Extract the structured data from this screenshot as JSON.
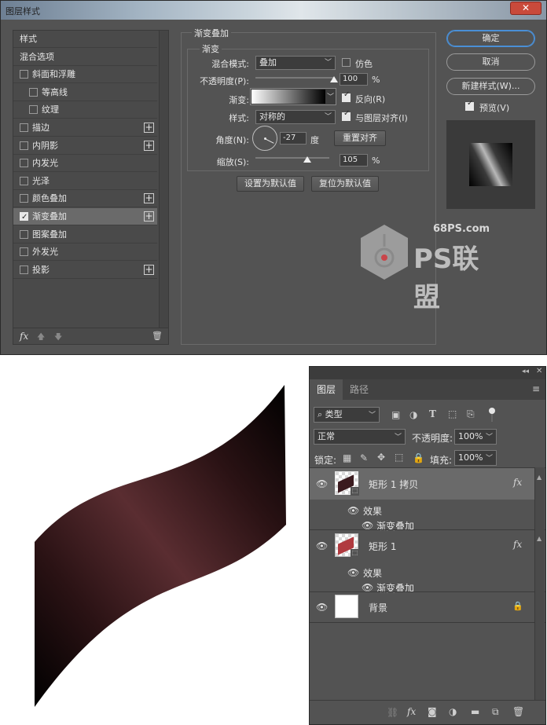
{
  "dialog": {
    "title": "图层样式",
    "close": "✕",
    "left_items": [
      {
        "label": "样式",
        "checkbox": false,
        "checked": false,
        "plus": false,
        "indent": 0
      },
      {
        "label": "混合选项",
        "checkbox": false,
        "checked": false,
        "plus": false,
        "indent": 0
      },
      {
        "label": "斜面和浮雕",
        "checkbox": true,
        "checked": false,
        "plus": false,
        "indent": 0
      },
      {
        "label": "等高线",
        "checkbox": true,
        "checked": false,
        "plus": false,
        "indent": 1
      },
      {
        "label": "纹理",
        "checkbox": true,
        "checked": false,
        "plus": false,
        "indent": 1
      },
      {
        "label": "描边",
        "checkbox": true,
        "checked": false,
        "plus": true,
        "indent": 0
      },
      {
        "label": "内阴影",
        "checkbox": true,
        "checked": false,
        "plus": true,
        "indent": 0
      },
      {
        "label": "内发光",
        "checkbox": true,
        "checked": false,
        "plus": false,
        "indent": 0
      },
      {
        "label": "光泽",
        "checkbox": true,
        "checked": false,
        "plus": false,
        "indent": 0
      },
      {
        "label": "颜色叠加",
        "checkbox": true,
        "checked": false,
        "plus": true,
        "indent": 0
      },
      {
        "label": "渐变叠加",
        "checkbox": true,
        "checked": true,
        "plus": true,
        "indent": 0
      },
      {
        "label": "图案叠加",
        "checkbox": true,
        "checked": false,
        "plus": false,
        "indent": 0
      },
      {
        "label": "外发光",
        "checkbox": true,
        "checked": false,
        "plus": false,
        "indent": 0
      },
      {
        "label": "投影",
        "checkbox": true,
        "checked": false,
        "plus": true,
        "indent": 0
      }
    ],
    "bottom_icons": {
      "fx": "fx",
      "up": "🡅",
      "down": "🡇",
      "trash": "🗑"
    },
    "section_title": "渐变叠加",
    "group_title": "渐变",
    "blend_mode_label": "混合模式:",
    "blend_mode_value": "叠加",
    "dither_label": "仿色",
    "opacity_label": "不透明度(P):",
    "opacity_value": "100",
    "opacity_percent": 1.0,
    "percent_sign": "%",
    "gradient_label": "渐变:",
    "reverse_label": "反向(R)",
    "style_label": "样式:",
    "style_value": "对称的",
    "align_label": "与图层对齐(I)",
    "angle_label": "角度(N):",
    "angle_value": "-27",
    "degree_label": "度",
    "reset_align_button": "重置对齐",
    "scale_label": "缩放(S):",
    "scale_value": "105",
    "scale_percent": 0.7,
    "make_default_button": "设置为默认值",
    "reset_default_button": "复位为默认值",
    "ok_button": "确定",
    "cancel_button": "取消",
    "new_style_button": "新建样式(W)...",
    "preview_label": "预览(V)",
    "watermark_url": "68PS.com",
    "watermark_text": "PS联盟"
  },
  "layers_panel": {
    "tabs": [
      "图层",
      "路径"
    ],
    "filter_label": "类型",
    "blend_value": "正常",
    "opacity_label": "不透明度:",
    "opacity_value": "100%",
    "lock_label": "锁定:",
    "fill_label": "填充:",
    "fill_value": "100%",
    "layers": [
      {
        "name": "矩形 1 拷贝",
        "fx": "fx",
        "effects_label": "效果",
        "effect": "渐变叠加",
        "selected": true
      },
      {
        "name": "矩形 1",
        "fx": "fx",
        "effects_label": "效果",
        "effect": "渐变叠加",
        "selected": false
      },
      {
        "name": "背景",
        "locked": true
      }
    ],
    "colors": {
      "shape_copy": "#3a1a1e",
      "shape": "#b03a3f"
    }
  }
}
